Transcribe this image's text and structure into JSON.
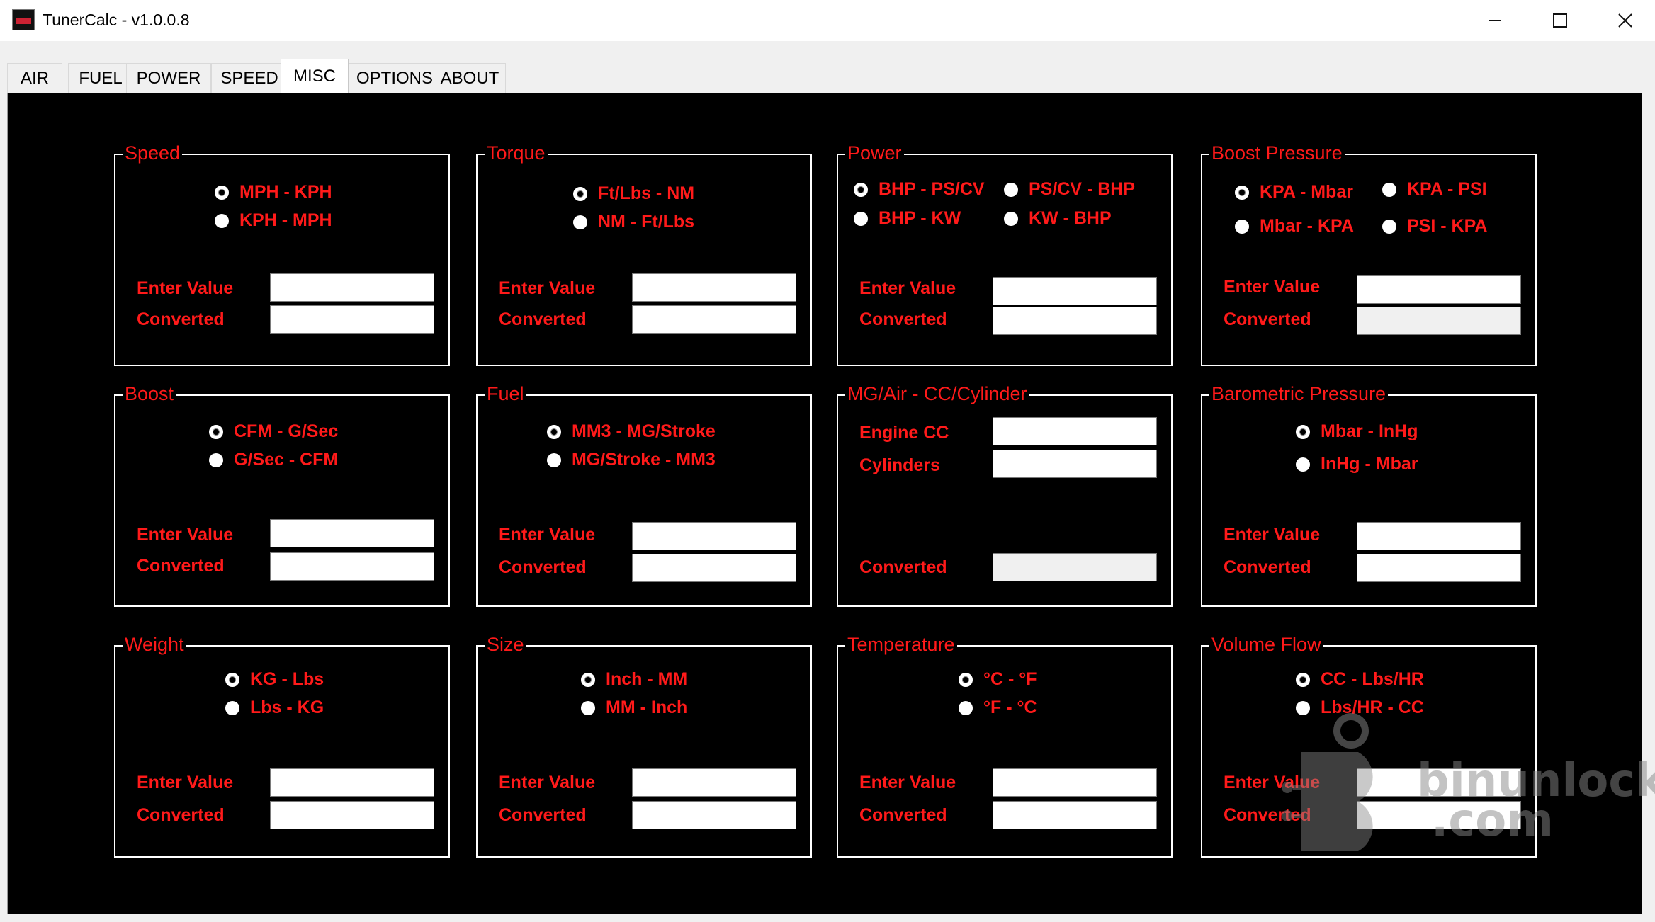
{
  "window": {
    "title": "TunerCalc - v1.0.0.8",
    "icons": {
      "minimize": "minimize-icon",
      "maximize": "maximize-icon",
      "close": "close-icon"
    }
  },
  "tabs": [
    {
      "label": "AIR"
    },
    {
      "label": "FUEL"
    },
    {
      "label": "POWER"
    },
    {
      "label": "SPEED"
    },
    {
      "label": "MISC"
    },
    {
      "label": "OPTIONS"
    },
    {
      "label": "ABOUT"
    }
  ],
  "active_tab": "MISC",
  "groups": [
    {
      "title": "Speed",
      "options": [
        "MPH - KPH",
        "KPH - MPH"
      ],
      "selected": 0,
      "enter_label": "Enter Value",
      "converted_label": "Converted",
      "enter_value": "",
      "converted_value": ""
    },
    {
      "title": "Torque",
      "options": [
        "Ft/Lbs - NM",
        "NM - Ft/Lbs"
      ],
      "selected": 0,
      "enter_label": "Enter Value",
      "converted_label": "Converted",
      "enter_value": "",
      "converted_value": ""
    },
    {
      "title": "Power",
      "options": [
        "BHP - PS/CV",
        "PS/CV - BHP",
        "BHP - KW",
        "KW - BHP"
      ],
      "selected": 0,
      "enter_label": "Enter Value",
      "converted_label": "Converted",
      "enter_value": "",
      "converted_value": ""
    },
    {
      "title": "Boost Pressure",
      "options": [
        "KPA - Mbar",
        "KPA - PSI",
        "Mbar - KPA",
        "PSI - KPA"
      ],
      "selected": 0,
      "enter_label": "Enter Value",
      "converted_label": "Converted",
      "enter_value": "",
      "converted_value": ""
    },
    {
      "title": "Boost",
      "options": [
        "CFM - G/Sec",
        "G/Sec - CFM"
      ],
      "selected": 0,
      "enter_label": "Enter Value",
      "converted_label": "Converted",
      "enter_value": "",
      "converted_value": ""
    },
    {
      "title": "Fuel",
      "options": [
        "MM3 - MG/Stroke",
        "MG/Stroke - MM3"
      ],
      "selected": 0,
      "enter_label": "Enter Value",
      "converted_label": "Converted",
      "enter_value": "",
      "converted_value": ""
    },
    {
      "title": "MG/Air - CC/Cylinder",
      "engine_label": "Engine CC",
      "cylinders_label": "Cylinders",
      "converted_label": "Converted",
      "engine_value": "",
      "cylinders_value": "",
      "converted_value": ""
    },
    {
      "title": "Barometric Pressure",
      "options": [
        "Mbar - InHg",
        "InHg - Mbar"
      ],
      "selected": 0,
      "enter_label": "Enter Value",
      "converted_label": "Converted",
      "enter_value": "",
      "converted_value": ""
    },
    {
      "title": "Weight",
      "options": [
        "KG - Lbs",
        "Lbs - KG"
      ],
      "selected": 0,
      "enter_label": "Enter Value",
      "converted_label": "Converted",
      "enter_value": "",
      "converted_value": ""
    },
    {
      "title": "Size",
      "options": [
        "Inch - MM",
        "MM - Inch"
      ],
      "selected": 0,
      "enter_label": "Enter Value",
      "converted_label": "Converted",
      "enter_value": "",
      "converted_value": ""
    },
    {
      "title": "Temperature",
      "options": [
        "°C - °F",
        "°F - °C"
      ],
      "selected": 0,
      "enter_label": "Enter Value",
      "converted_label": "Converted",
      "enter_value": "",
      "converted_value": ""
    },
    {
      "title": "Volume Flow",
      "options": [
        "CC - Lbs/HR",
        "Lbs/HR - CC"
      ],
      "selected": 0,
      "enter_label": "Enter Value",
      "converted_label": "Converted",
      "enter_value": "",
      "converted_value": ""
    }
  ],
  "watermark": {
    "line1": "binunlock",
    "line2": ".com"
  },
  "colors": {
    "panel_bg": "#000000",
    "label_red": "#ff1a1a",
    "box_border": "#ffffff",
    "window_bg": "#f0f0f0"
  }
}
